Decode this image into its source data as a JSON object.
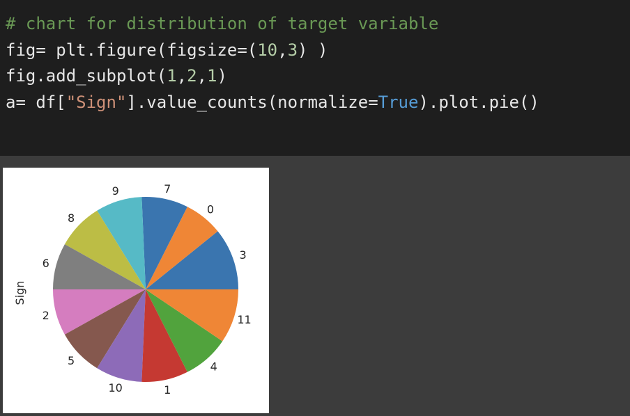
{
  "code": {
    "line1": {
      "comment": "# chart for distribution of target variable"
    },
    "line2": {
      "p1": "fig= plt.figure(figsize=(",
      "n1": "10",
      "p2": ",",
      "n2": "3",
      "p3": ") )"
    },
    "line3": {
      "p1": "fig.add_subplot(",
      "n1": "1",
      "p2": ",",
      "n2": "2",
      "p3": ",",
      "n3": "1",
      "p4": ")"
    },
    "line4": {
      "p1": "a= df[",
      "s1": "\"Sign\"",
      "p2": "].value_counts(normalize=",
      "kw": "True",
      "p3": ").plot.pie()"
    }
  },
  "chart_data": {
    "type": "pie",
    "ylabel": "Sign",
    "slices": [
      {
        "label": "3",
        "value": 0.1111,
        "color": "#3a75af"
      },
      {
        "label": "0",
        "value": 0.0694,
        "color": "#ef8636"
      },
      {
        "label": "7",
        "value": 0.0833,
        "color": "#3a75af"
      },
      {
        "label": "9",
        "value": 0.0833,
        "color": "#56bac6"
      },
      {
        "label": "8",
        "value": 0.0833,
        "color": "#bcbd45"
      },
      {
        "label": "6",
        "value": 0.0833,
        "color": "#7f7f7f"
      },
      {
        "label": "2",
        "value": 0.0833,
        "color": "#d57dbf"
      },
      {
        "label": "5",
        "value": 0.0833,
        "color": "#85584e"
      },
      {
        "label": "10",
        "value": 0.0833,
        "color": "#8d6bb8"
      },
      {
        "label": "1",
        "value": 0.0833,
        "color": "#c53932"
      },
      {
        "label": "4",
        "value": 0.0833,
        "color": "#51a33d"
      },
      {
        "label": "11",
        "value": 0.0972,
        "color": "#ef8636"
      }
    ]
  }
}
